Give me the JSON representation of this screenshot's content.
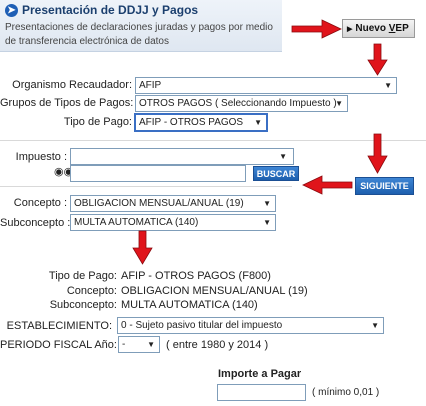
{
  "header": {
    "title": "Presentación de DDJJ y Pagos",
    "description": "Presentaciones de declaraciones juradas y pagos por medio de transferencia electrónica de datos"
  },
  "nuevo_vep": {
    "prefix": "Nuevo ",
    "underlined": "V",
    "suffix": "EP"
  },
  "form": {
    "organismo": {
      "label": "Organismo Recaudador:",
      "value": "AFIP"
    },
    "grupos": {
      "label": "Grupos de Tipos de Pagos:",
      "value": "OTROS PAGOS ( Seleccionando Impuesto )"
    },
    "tipo_pago": {
      "label": "Tipo de Pago:",
      "value": "AFIP - OTROS PAGOS"
    },
    "impuesto": {
      "label": "Impuesto :",
      "value": ""
    },
    "buscar": {
      "label": "BUSCAR"
    },
    "siguiente": {
      "label": "SIGUIENTE"
    },
    "concepto": {
      "label": "Concepto :",
      "value": "OBLIGACION MENSUAL/ANUAL (19)"
    },
    "subconcepto": {
      "label": "Subconcepto :",
      "value": "MULTA AUTOMATICA (140)"
    }
  },
  "summary": [
    {
      "label": "Tipo de Pago:",
      "value": "AFIP - OTROS PAGOS (F800)"
    },
    {
      "label": "Concepto:",
      "value": "OBLIGACION MENSUAL/ANUAL (19)"
    },
    {
      "label": "Subconcepto:",
      "value": "MULTA AUTOMATICA (140)"
    }
  ],
  "establecimiento": {
    "label": "ESTABLECIMIENTO:",
    "value": "0 - Sujeto pasivo titular del impuesto"
  },
  "periodo": {
    "label": "PERIODO FISCAL Año:",
    "value": "-",
    "range_text": "( entre 1980 y 2014 )"
  },
  "importe": {
    "title": "Importe a Pagar",
    "value": "",
    "minimo": "( mínimo 0,01 )"
  },
  "colors": {
    "arrow": "#e0141b",
    "button": "#2a6fc0",
    "header_title": "#1b3f6e"
  },
  "icons": [
    "arrow-circle-icon",
    "binoculars-icon",
    "dropdown-caret-icon"
  ]
}
